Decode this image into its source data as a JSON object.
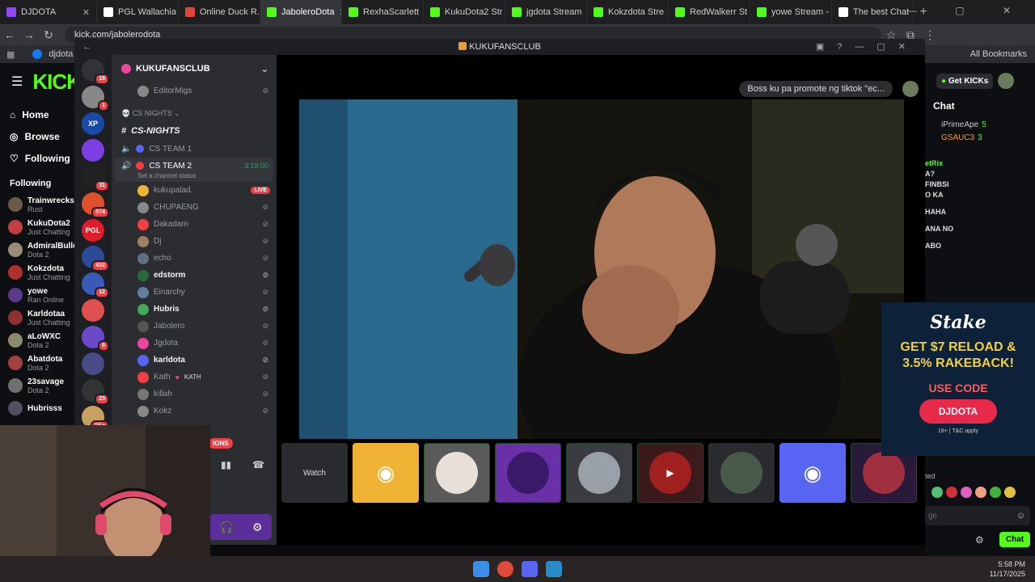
{
  "tabs": [
    {
      "title": "DJDOTA",
      "color": "#9146ff"
    },
    {
      "title": "PGL Wallachia",
      "color": "#ffffff"
    },
    {
      "title": "Online Duck R...",
      "color": "#e0453a"
    },
    {
      "title": "JaboleroDota",
      "color": "#53fc18",
      "active": true
    },
    {
      "title": "RexhaScarlett",
      "color": "#53fc18"
    },
    {
      "title": "KukuDota2 Str",
      "color": "#53fc18"
    },
    {
      "title": "jgdota Stream",
      "color": "#53fc18"
    },
    {
      "title": "Kokzdota Stre",
      "color": "#53fc18"
    },
    {
      "title": "RedWalkerr St",
      "color": "#53fc18"
    },
    {
      "title": "yowe Stream -",
      "color": "#53fc18"
    },
    {
      "title": "The best Chat",
      "color": "#ffffff"
    }
  ],
  "address": {
    "url": "kick.com/jabolerodota"
  },
  "bookmarks": {
    "item": "djdota",
    "all_label": "All Bookmarks"
  },
  "kick": {
    "logo": "KICK",
    "nav": [
      {
        "label": "Home",
        "icon": "home-icon"
      },
      {
        "label": "Browse",
        "icon": "compass-icon"
      },
      {
        "label": "Following",
        "icon": "heart-icon"
      }
    ],
    "following_label": "Following",
    "following": [
      {
        "name": "Trainwrecks",
        "game": "Rust"
      },
      {
        "name": "KukuDota2",
        "game": "Just Chatting"
      },
      {
        "name": "AdmiralBulld",
        "game": "Dota 2"
      },
      {
        "name": "Kokzdota",
        "game": "Just Chatting"
      },
      {
        "name": "yowe",
        "game": "Ran Online"
      },
      {
        "name": "Karldotaa",
        "game": "Just Chatting"
      },
      {
        "name": "aLoWXC",
        "game": "Dota 2"
      },
      {
        "name": "Abatdota",
        "game": "Dota 2"
      },
      {
        "name": "23savage",
        "game": "Dota 2"
      },
      {
        "name": "Hubrisss",
        "game": ""
      }
    ],
    "get_kicks": "Get KICKs",
    "chat_title": "Chat",
    "chat_users": [
      {
        "name": "iPrimeApe",
        "count": "5"
      },
      {
        "name": "GSAUC3",
        "count": "3"
      }
    ],
    "chat_lines": [
      "etRix",
      "A?",
      "FINBSI",
      "O KA",
      "HAHA",
      "ANA NO",
      "ABO"
    ],
    "chat_send": "Chat",
    "chat_placeholder": "ge",
    "chat_sent_label": "ted"
  },
  "stake": {
    "logo": "Stake",
    "line1": "GET $7 RELOAD &",
    "line2": "3.5% RAKEBACK!",
    "use_code": "USE CODE",
    "code": "DJDOTA",
    "fine": "18+ | T&C apply"
  },
  "discord": {
    "window_title": "KUKUFANSCLUB",
    "server_name": "KUKUFANSCLUB",
    "servers": [
      {
        "badge": "18",
        "color": "#313338"
      },
      {
        "badge": "1",
        "color": "#888888"
      },
      {
        "badge": "",
        "label": "XP",
        "color": "#1a4aa8"
      },
      {
        "badge": "",
        "color": "#7b3fe4"
      },
      {
        "badge": "31",
        "color": "#222222"
      },
      {
        "badge": "574",
        "color": "#e0502a"
      },
      {
        "badge": "",
        "label": "PGL",
        "color": "#e01b2a"
      },
      {
        "badge": "432",
        "color": "#2c4a9a"
      },
      {
        "badge": "12",
        "color": "#3a5ab8"
      },
      {
        "badge": "",
        "color": "#e05050"
      },
      {
        "badge": "6",
        "color": "#6a4ac8"
      },
      {
        "badge": "",
        "color": "#4a4a88"
      },
      {
        "badge": "23",
        "color": "#333333"
      },
      {
        "badge": "1K+",
        "color": "#c8a060"
      }
    ],
    "category": "CS NIGHTS",
    "text_channel": "CS-NIGHTS",
    "voice1": "CS TEAM 1",
    "voice2": "CS TEAM 2",
    "voice2_timer": "3:18:00",
    "voice2_status": "Set a channel status",
    "top_member": "EditorMigs",
    "members": [
      {
        "name": "kukupalad.",
        "bright": false,
        "live": "LIVE",
        "color": "#f0b232"
      },
      {
        "name": "CHUPAENG",
        "bright": false,
        "color": "#888888"
      },
      {
        "name": "Dakadam",
        "bright": false,
        "color": "#f23f43"
      },
      {
        "name": "Dj",
        "bright": false,
        "color": "#a08060"
      },
      {
        "name": "echo",
        "bright": false,
        "color": "#607080"
      },
      {
        "name": "edstorm",
        "bright": true,
        "color": "#2a6a3a"
      },
      {
        "name": "Einarchy",
        "bright": false,
        "color": "#6080a0"
      },
      {
        "name": "Hubris",
        "bright": true,
        "color": "#44aa55"
      },
      {
        "name": "Jabolero",
        "bright": false,
        "color": "#555555"
      },
      {
        "name": "Jgdota",
        "bright": false,
        "color": "#eb459e"
      },
      {
        "name": "karldota",
        "bright": true,
        "color": "#5865f2"
      },
      {
        "name": "Kath",
        "bright": false,
        "tag": "KATH",
        "color": "#f23f43"
      },
      {
        "name": "killah",
        "bright": false,
        "color": "#777777"
      },
      {
        "name": "Kokz",
        "bright": false,
        "color": "#888888"
      }
    ],
    "live_badge": "IONS",
    "overlay_message": "Boss ku pa promote ng tiktok \"ec...",
    "watch_label": "Watch"
  },
  "taskbar": {
    "time": "5:58 PM",
    "date": "11/17/2025"
  }
}
